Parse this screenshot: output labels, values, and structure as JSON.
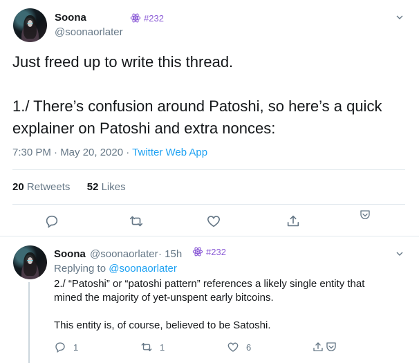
{
  "main_tweet": {
    "author_name": "Soona",
    "author_handle": "@soonaorlater",
    "badge_text": "#232",
    "text_line1": "Just freed up to write this thread.",
    "text_line2": "1./ There’s confusion around Patoshi, so here’s a quick",
    "text_line3": "explainer on Patoshi and extra nonces:",
    "time": "7:30 PM · May 20, 2020 · ",
    "source": "Twitter Web App",
    "retweets_count": "20",
    "retweets_label": "Retweets",
    "likes_count": "52",
    "likes_label": "Likes"
  },
  "reply_tweet": {
    "author_name": "Soona",
    "author_handle": "@soonaorlater",
    "time_ago": "· 15h",
    "badge_text": "#232",
    "replying_prefix": "Replying to ",
    "replying_handle": "@soonaorlater",
    "text_line1": "2./ “Patoshi” or “patoshi pattern” references a likely single entity that",
    "text_line2": "mined the majority of yet-unspent early bitcoins.",
    "text_line3": "This entity is, of course, believed to be Satoshi.",
    "reply_count": "1",
    "retweet_count": "1",
    "like_count": "6"
  },
  "icons": {
    "reply": "speech-bubble-icon",
    "retweet": "retweet-arrows-icon",
    "like": "heart-icon",
    "share": "share-upload-icon",
    "bookmark": "save-to-pocket-icon",
    "badge": "atom-icon",
    "more": "chevron-down-icon"
  },
  "colors": {
    "link": "#1da1f2",
    "muted": "#657786",
    "badge": "#8b5bd6",
    "text": "#14171a"
  }
}
